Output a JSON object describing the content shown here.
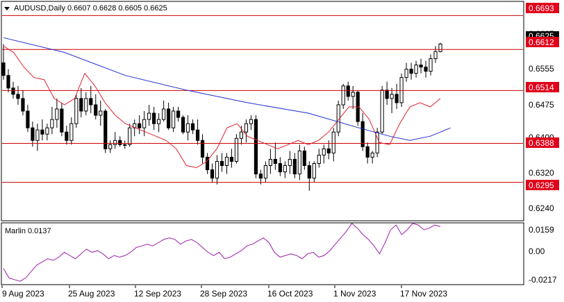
{
  "header": {
    "symbol_line": "AUDUSD,Daily  0.6607 0.6628 0.6605 0.6625"
  },
  "price_axis": {
    "ticks": [
      "0.6625",
      "0.6555",
      "0.6475",
      "0.6400",
      "0.6320",
      "0.6240"
    ]
  },
  "levels": [
    {
      "value": "0.6693",
      "price": 0.6693
    },
    {
      "value": "0.6612",
      "price": 0.6612
    },
    {
      "value": "0.6514",
      "price": 0.6514
    },
    {
      "value": "0.6388",
      "price": 0.6388
    },
    {
      "value": "0.6295",
      "price": 0.6295
    }
  ],
  "current_price": "0.6625",
  "indicator": {
    "label": "Marlin 0.0137",
    "ticks": [
      "0.0159",
      "0.00",
      "-0.0217"
    ]
  },
  "time_axis": {
    "labels": [
      "9 Aug 2023",
      "25 Aug 2023",
      "12 Sep 2023",
      "28 Sep 2023",
      "16 Oct 2023",
      "1 Nov 2023",
      "17 Nov 2023"
    ]
  },
  "colors": {
    "level_line": "#cc0000",
    "level_label_bg": "#e0001a",
    "ma_fast": "#e0202a",
    "ma_slow": "#1f2fd0",
    "indicator_line": "#9c1fa8",
    "candle": "#000000"
  },
  "chart_data": {
    "type": "candlestick",
    "symbol": "AUDUSD",
    "timeframe": "Daily",
    "last_bar": {
      "open": 0.6607,
      "high": 0.6628,
      "low": 0.6605,
      "close": 0.6625
    },
    "y_range": [
      0.6205,
      0.6725
    ],
    "horizontal_levels": [
      0.6693,
      0.6612,
      0.6514,
      0.6388,
      0.6295
    ],
    "candles": [
      [
        0.658,
        0.6625,
        0.654,
        0.655
      ],
      [
        0.655,
        0.6565,
        0.651,
        0.652
      ],
      [
        0.652,
        0.6535,
        0.6495,
        0.6505
      ],
      [
        0.6505,
        0.6525,
        0.648,
        0.6495
      ],
      [
        0.6495,
        0.6515,
        0.6455,
        0.6465
      ],
      [
        0.6465,
        0.648,
        0.6415,
        0.6425
      ],
      [
        0.6425,
        0.644,
        0.638,
        0.6395
      ],
      [
        0.6395,
        0.6435,
        0.637,
        0.642
      ],
      [
        0.642,
        0.6445,
        0.6395,
        0.641
      ],
      [
        0.641,
        0.6435,
        0.6395,
        0.6425
      ],
      [
        0.6425,
        0.6475,
        0.641,
        0.6445
      ],
      [
        0.6445,
        0.6495,
        0.6425,
        0.647
      ],
      [
        0.647,
        0.6485,
        0.6405,
        0.6415
      ],
      [
        0.6415,
        0.643,
        0.6385,
        0.6395
      ],
      [
        0.6395,
        0.645,
        0.6385,
        0.6435
      ],
      [
        0.6435,
        0.6505,
        0.6425,
        0.6495
      ],
      [
        0.6495,
        0.652,
        0.645,
        0.6465
      ],
      [
        0.6465,
        0.651,
        0.6455,
        0.6495
      ],
      [
        0.6495,
        0.6525,
        0.646,
        0.648
      ],
      [
        0.648,
        0.6505,
        0.6445,
        0.6455
      ],
      [
        0.6455,
        0.649,
        0.643,
        0.6465
      ],
      [
        0.6465,
        0.647,
        0.6365,
        0.6375
      ],
      [
        0.6375,
        0.6395,
        0.6365,
        0.6385
      ],
      [
        0.6385,
        0.6415,
        0.6375,
        0.6395
      ],
      [
        0.6395,
        0.6405,
        0.638,
        0.6385
      ],
      [
        0.6385,
        0.6395,
        0.6375,
        0.6385
      ],
      [
        0.6385,
        0.6435,
        0.638,
        0.6425
      ],
      [
        0.6425,
        0.6445,
        0.6405,
        0.6435
      ],
      [
        0.6435,
        0.6455,
        0.641,
        0.6425
      ],
      [
        0.6425,
        0.6465,
        0.6405,
        0.6445
      ],
      [
        0.6445,
        0.648,
        0.643,
        0.646
      ],
      [
        0.646,
        0.6475,
        0.642,
        0.6435
      ],
      [
        0.6435,
        0.646,
        0.6415,
        0.6445
      ],
      [
        0.6445,
        0.649,
        0.644,
        0.647
      ],
      [
        0.647,
        0.6485,
        0.642,
        0.6425
      ],
      [
        0.6425,
        0.6475,
        0.6415,
        0.6465
      ],
      [
        0.6465,
        0.6475,
        0.644,
        0.645
      ],
      [
        0.645,
        0.6455,
        0.641,
        0.6415
      ],
      [
        0.6415,
        0.6455,
        0.6395,
        0.6435
      ],
      [
        0.6435,
        0.6445,
        0.641,
        0.642
      ],
      [
        0.642,
        0.6445,
        0.6385,
        0.6395
      ],
      [
        0.6395,
        0.641,
        0.634,
        0.6355
      ],
      [
        0.6355,
        0.6365,
        0.6315,
        0.6325
      ],
      [
        0.6325,
        0.634,
        0.6295,
        0.6305
      ],
      [
        0.6305,
        0.636,
        0.629,
        0.6345
      ],
      [
        0.6345,
        0.6365,
        0.632,
        0.6335
      ],
      [
        0.6335,
        0.6365,
        0.6315,
        0.6355
      ],
      [
        0.6355,
        0.6375,
        0.633,
        0.6345
      ],
      [
        0.6345,
        0.641,
        0.634,
        0.64
      ],
      [
        0.64,
        0.643,
        0.6385,
        0.6415
      ],
      [
        0.6415,
        0.6445,
        0.639,
        0.6435
      ],
      [
        0.6435,
        0.6455,
        0.642,
        0.6445
      ],
      [
        0.6445,
        0.6455,
        0.6305,
        0.6315
      ],
      [
        0.6315,
        0.6325,
        0.629,
        0.6305
      ],
      [
        0.6305,
        0.6345,
        0.6295,
        0.6335
      ],
      [
        0.6335,
        0.6375,
        0.6315,
        0.635
      ],
      [
        0.635,
        0.639,
        0.6325,
        0.634
      ],
      [
        0.634,
        0.6355,
        0.631,
        0.632
      ],
      [
        0.632,
        0.6345,
        0.6305,
        0.6335
      ],
      [
        0.6335,
        0.637,
        0.6315,
        0.635
      ],
      [
        0.635,
        0.6365,
        0.6305,
        0.6315
      ],
      [
        0.6315,
        0.6385,
        0.63,
        0.637
      ],
      [
        0.637,
        0.638,
        0.6325,
        0.6335
      ],
      [
        0.6335,
        0.6345,
        0.6275,
        0.6305
      ],
      [
        0.6305,
        0.6345,
        0.6295,
        0.634
      ],
      [
        0.634,
        0.6375,
        0.633,
        0.636
      ],
      [
        0.636,
        0.6385,
        0.634,
        0.6375
      ],
      [
        0.6375,
        0.6395,
        0.635,
        0.6365
      ],
      [
        0.6365,
        0.6425,
        0.6345,
        0.6415
      ],
      [
        0.6415,
        0.649,
        0.6405,
        0.648
      ],
      [
        0.648,
        0.653,
        0.647,
        0.6525
      ],
      [
        0.6525,
        0.6535,
        0.649,
        0.65
      ],
      [
        0.65,
        0.6525,
        0.647,
        0.651
      ],
      [
        0.651,
        0.6515,
        0.643,
        0.644
      ],
      [
        0.644,
        0.646,
        0.637,
        0.638
      ],
      [
        0.638,
        0.639,
        0.634,
        0.6355
      ],
      [
        0.6355,
        0.637,
        0.634,
        0.6365
      ],
      [
        0.6365,
        0.6425,
        0.6355,
        0.6415
      ],
      [
        0.6415,
        0.6525,
        0.641,
        0.6515
      ],
      [
        0.6515,
        0.6535,
        0.648,
        0.6495
      ],
      [
        0.6495,
        0.652,
        0.646,
        0.6505
      ],
      [
        0.6505,
        0.653,
        0.647,
        0.6485
      ],
      [
        0.6485,
        0.6555,
        0.6475,
        0.6545
      ],
      [
        0.6545,
        0.658,
        0.6535,
        0.6565
      ],
      [
        0.6565,
        0.658,
        0.654,
        0.6555
      ],
      [
        0.6555,
        0.6585,
        0.6545,
        0.6575
      ],
      [
        0.6575,
        0.659,
        0.6555,
        0.657
      ],
      [
        0.657,
        0.6585,
        0.6545,
        0.656
      ],
      [
        0.656,
        0.66,
        0.655,
        0.659
      ],
      [
        0.659,
        0.662,
        0.658,
        0.6607
      ],
      [
        0.6607,
        0.6628,
        0.6605,
        0.6625
      ]
    ],
    "ma_fast_points": [
      [
        0,
        0.662
      ],
      [
        5,
        0.6605
      ],
      [
        10,
        0.657
      ],
      [
        15,
        0.6545
      ],
      [
        20,
        0.654
      ],
      [
        25,
        0.6495
      ],
      [
        30,
        0.648
      ],
      [
        35,
        0.6495
      ],
      [
        40,
        0.6555
      ],
      [
        45,
        0.6525
      ],
      [
        50,
        0.6485
      ],
      [
        55,
        0.6455
      ],
      [
        60,
        0.6435
      ],
      [
        65,
        0.6425
      ],
      [
        70,
        0.6415
      ],
      [
        75,
        0.6405
      ],
      [
        80,
        0.6395
      ],
      [
        85,
        0.6375
      ],
      [
        90,
        0.6335
      ],
      [
        95,
        0.633
      ],
      [
        100,
        0.6345
      ],
      [
        105,
        0.6375
      ],
      [
        110,
        0.6425
      ],
      [
        115,
        0.6435
      ],
      [
        120,
        0.6405
      ],
      [
        125,
        0.6395
      ],
      [
        130,
        0.6385
      ],
      [
        135,
        0.6375
      ],
      [
        140,
        0.6385
      ],
      [
        145,
        0.6395
      ],
      [
        150,
        0.6385
      ],
      [
        155,
        0.6395
      ],
      [
        160,
        0.6415
      ],
      [
        165,
        0.6445
      ],
      [
        170,
        0.6475
      ],
      [
        175,
        0.6475
      ],
      [
        180,
        0.6445
      ],
      [
        185,
        0.639
      ],
      [
        190,
        0.6385
      ],
      [
        195,
        0.6435
      ],
      [
        200,
        0.6475
      ],
      [
        205,
        0.6485
      ],
      [
        210,
        0.6475
      ],
      [
        215,
        0.6495
      ]
    ],
    "ma_slow_points": [
      [
        0,
        0.664
      ],
      [
        30,
        0.6605
      ],
      [
        60,
        0.655
      ],
      [
        90,
        0.6515
      ],
      [
        120,
        0.6485
      ],
      [
        150,
        0.646
      ],
      [
        175,
        0.6425
      ],
      [
        190,
        0.6405
      ],
      [
        200,
        0.6395
      ],
      [
        210,
        0.6405
      ],
      [
        220,
        0.6425
      ]
    ],
    "indicator": {
      "name": "Marlin",
      "last_value": 0.0137,
      "y_range": [
        -0.0217,
        0.0159
      ],
      "values": [
        -0.012,
        -0.018,
        -0.019,
        -0.02,
        -0.018,
        -0.014,
        -0.01,
        -0.008,
        -0.006,
        -0.007,
        -0.005,
        -0.002,
        -0.004,
        -0.006,
        -0.003,
        0.0,
        -0.002,
        -0.001,
        -0.003,
        -0.006,
        -0.004,
        -0.005,
        -0.004,
        -0.002,
        0.001,
        0.002,
        0.003,
        0.002,
        0.004,
        0.006,
        0.007,
        0.006,
        0.003,
        0.005,
        0.006,
        0.004,
        0.001,
        -0.002,
        -0.004,
        -0.002,
        -0.006,
        -0.005,
        -0.003,
        -0.001,
        0.002,
        0.003,
        0.005,
        0.007,
        0.004,
        -0.002,
        -0.005,
        -0.004,
        -0.003,
        -0.004,
        -0.006,
        -0.003,
        -0.002,
        -0.005,
        -0.004,
        -0.001,
        0.003,
        0.007,
        0.011,
        0.016,
        0.013,
        0.009,
        0.006,
        0.002,
        -0.003,
        0.004,
        0.012,
        0.015,
        0.009,
        0.012,
        0.016,
        0.015,
        0.012,
        0.013,
        0.015,
        0.014
      ]
    }
  }
}
